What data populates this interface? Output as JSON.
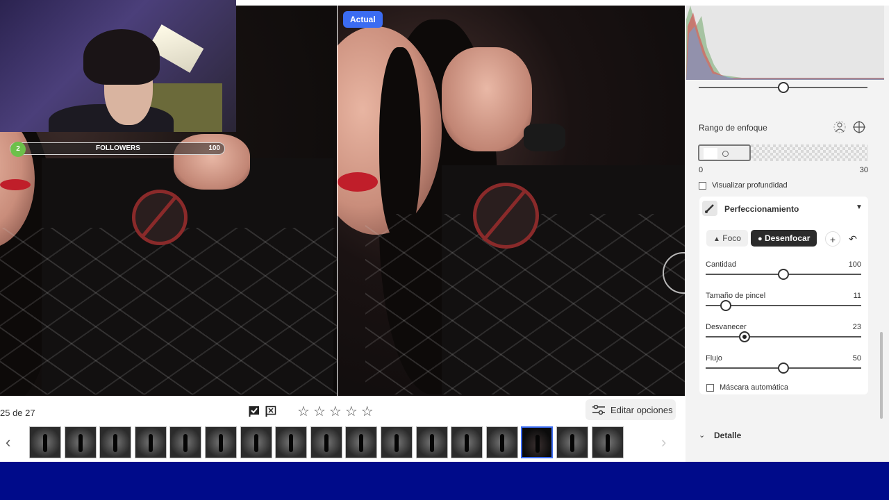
{
  "viewer": {
    "badge_after": "Actual",
    "counter": "25 de 27",
    "edit_options_label": "Editar opciones"
  },
  "rating": {
    "stars_total": 5,
    "stars_filled": 0
  },
  "filmstrip": {
    "count": 17,
    "selected_index": 14
  },
  "stream_overlay": {
    "followers_count": "2",
    "followers_label": "FOLLOWERS",
    "followers_goal": "100"
  },
  "panel": {
    "focus_range": {
      "title": "Rango de enfoque",
      "min_label": "0",
      "max_label": "30"
    },
    "visualize_depth_label": "Visualizar profundidad",
    "refine": {
      "title": "Perfeccionamiento",
      "mode_focus": "Foco",
      "mode_blur": "Desenfocar",
      "sliders": [
        {
          "label": "Cantidad",
          "value": "100",
          "position": 0.5
        },
        {
          "label": "Tamaño de pincel",
          "value": "11",
          "position": 0.13
        },
        {
          "label": "Desvanecer",
          "value": "23",
          "position": 0.25
        },
        {
          "label": "Flujo",
          "value": "50",
          "position": 0.5
        }
      ],
      "auto_mask_label": "Máscara automática"
    },
    "detail_section": "Detalle"
  }
}
